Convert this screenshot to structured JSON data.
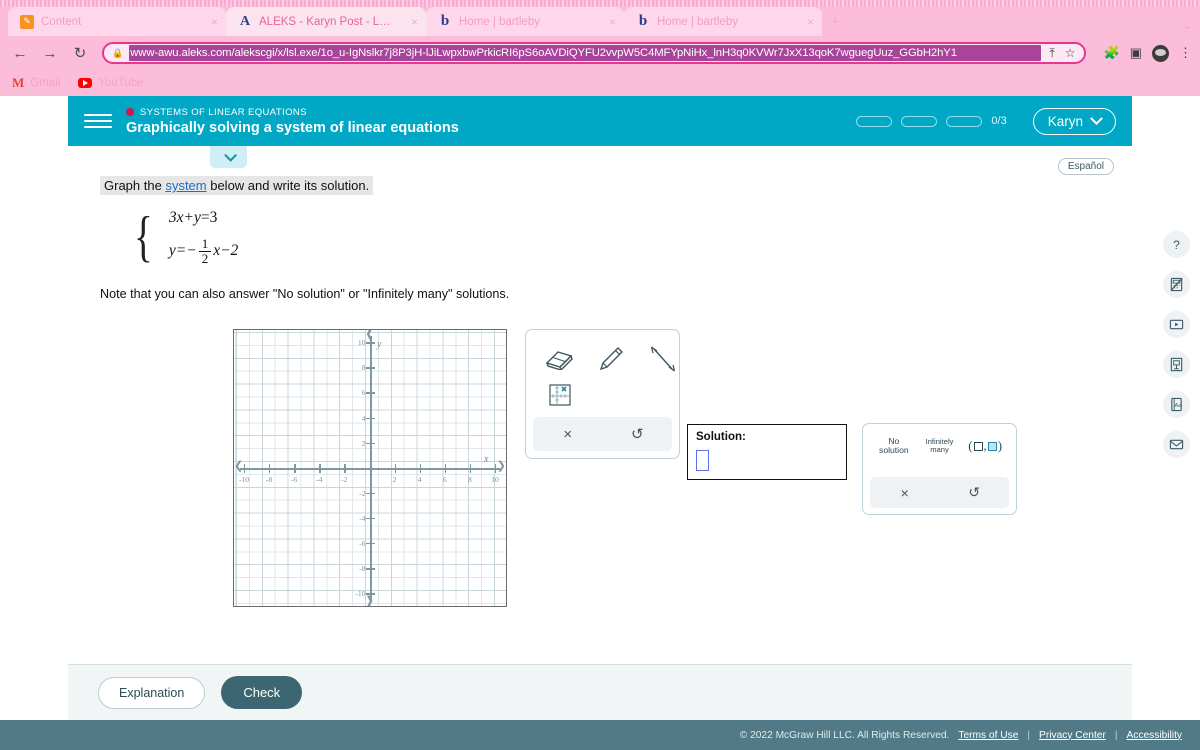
{
  "browser": {
    "tabs": [
      {
        "title": "Content",
        "favicon": "pencil-icon",
        "active": false
      },
      {
        "title": "ALEKS - Karyn Post - Learn",
        "favicon": "letter-a-icon",
        "active": true
      },
      {
        "title": "Home | bartleby",
        "favicon": "letter-b-icon",
        "active": false
      },
      {
        "title": "Home | bartleby",
        "favicon": "letter-b-icon",
        "active": false
      }
    ],
    "new_tab_label": "+",
    "tab_list_label": "⌄",
    "close_label": "×",
    "nav": {
      "back": "←",
      "forward": "→",
      "reload": "↻"
    },
    "omnibox": {
      "lock": "🔒",
      "url": "www-awu.aleks.com/alekscgi/x/lsl.exe/1o_u-IgNslkr7j8P3jH-lJiLwpxbwPrkicRI6pS6oAVDiQYFU2vvpW5C4MFYpNiHx_lnH3q0KVWr7JxX13qoK7wguegUuz_GGbH2hY1",
      "share": "⇧",
      "bookmark": "☆"
    },
    "toolbar_icons": [
      "extensions-icon",
      "side-panel-icon",
      "profile-avatar-icon",
      "browser-menu-icon"
    ],
    "bookmarks": [
      {
        "label": "Gmail",
        "icon": "gmail-icon"
      },
      {
        "label": "YouTube",
        "icon": "youtube-icon"
      }
    ]
  },
  "aleks": {
    "menu_icon": "hamburger-menu-icon",
    "kicker": "SYSTEMS OF LINEAR EQUATIONS",
    "title": "Graphically solving a system of linear equations",
    "progress": {
      "segments": 3,
      "filled": 0,
      "text": "0/3"
    },
    "user": {
      "name": "Karyn",
      "chevron": "chevron-down-icon"
    },
    "collapse_chevron": "chevron-down-icon",
    "espanol": "Español"
  },
  "problem": {
    "prompt_before": "Graph the ",
    "prompt_link": "system",
    "prompt_after": " below and write its solution.",
    "equation_1": {
      "lhs": "3x+y",
      "eq": "=",
      "rhs": "3"
    },
    "equation_2": {
      "pre": "y=−",
      "num": "1",
      "den": "2",
      "post": "x−2"
    },
    "note": "Note that you can also answer \"No solution\" or \"Infinitely many\" solutions."
  },
  "graph": {
    "x_ticks": [
      "-10",
      "-8",
      "-6",
      "-4",
      "-2",
      "2",
      "4",
      "6",
      "8",
      "10"
    ],
    "y_ticks": [
      "10",
      "8",
      "6",
      "4",
      "2",
      "-2",
      "-4",
      "-6",
      "-8",
      "-10"
    ],
    "x_label": "x",
    "y_label": "y",
    "xlim": [
      -11,
      11
    ],
    "ylim": [
      -11,
      11
    ],
    "plotted": []
  },
  "tools": {
    "items": [
      {
        "name": "eraser-tool",
        "label": "Eraser"
      },
      {
        "name": "pencil-tool",
        "label": "Pencil"
      },
      {
        "name": "line-tool",
        "label": "Line"
      },
      {
        "name": "graph-point-tool",
        "label": "Plot point"
      }
    ],
    "clear_label": "×",
    "undo_label": "↺"
  },
  "solution": {
    "label": "Solution:",
    "value": ""
  },
  "keypad": {
    "no_solution_line1": "No",
    "no_solution_line2": "solution",
    "infinitely_line1": "Infinitely",
    "infinitely_line2": "many",
    "ordered_pair_open": "(",
    "ordered_pair_comma": ",",
    "ordered_pair_close": ")",
    "clear_label": "×",
    "undo_label": "↺"
  },
  "rail": [
    {
      "name": "help-icon",
      "glyph": "?"
    },
    {
      "name": "calculator-disabled-icon",
      "glyph": ""
    },
    {
      "name": "video-player-icon",
      "glyph": ""
    },
    {
      "name": "reference-sheet-icon",
      "glyph": ""
    },
    {
      "name": "dictionary-icon",
      "glyph": "Aa"
    },
    {
      "name": "message-envelope-icon",
      "glyph": ""
    }
  ],
  "actions": {
    "explanation": "Explanation",
    "check": "Check"
  },
  "footer": {
    "copyright": "© 2022 McGraw Hill LLC. All Rights Reserved.",
    "links": [
      "Terms of Use",
      "Privacy Center",
      "Accessibility"
    ],
    "separator": "|"
  },
  "colors": {
    "aleks_teal": "#00a8c6",
    "check_button": "#3c6672",
    "footer": "#527a86",
    "browser_pink": "#fbbdd9",
    "url_highlight": "#a8449a",
    "input_blue": "#5b6ef5"
  }
}
